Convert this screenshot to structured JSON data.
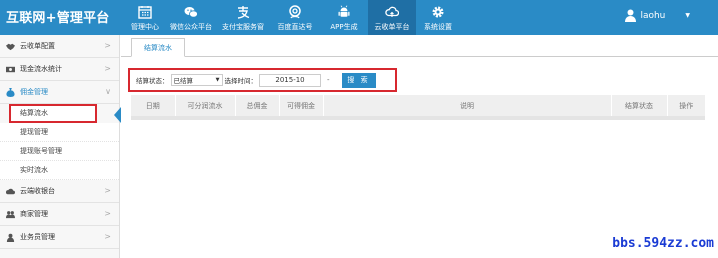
{
  "app": {
    "title": "互联网+管理平台"
  },
  "nav": {
    "items": [
      {
        "label": "管理中心",
        "icon": "calendar-grid-icon",
        "active": false
      },
      {
        "label": "微信公众平台",
        "icon": "wechat-icon",
        "active": false
      },
      {
        "label": "支付宝服务窗",
        "icon": "alipay-icon",
        "active": false
      },
      {
        "label": "百度直达号",
        "icon": "baidu-icon",
        "active": false
      },
      {
        "label": "APP生成",
        "icon": "android-icon",
        "active": false
      },
      {
        "label": "云收单平台",
        "icon": "cloud-upload-icon",
        "active": true
      },
      {
        "label": "系统设置",
        "icon": "gear-icon",
        "active": false
      }
    ]
  },
  "user": {
    "name": "laohu"
  },
  "sidebar": {
    "menus": [
      {
        "label": "云收单配置",
        "icon": "handshake-icon"
      },
      {
        "label": "现金流水统计",
        "icon": "cash-icon"
      },
      {
        "label": "佣金管理",
        "icon": "money-bag-icon",
        "open": true
      },
      {
        "label": "云端收银台",
        "icon": "cloud-icon"
      },
      {
        "label": "商家管理",
        "icon": "users-icon"
      },
      {
        "label": "业务员管理",
        "icon": "user-icon"
      }
    ],
    "sub_items": [
      "结算流水",
      "提现管理",
      "提现账号管理",
      "实时流水"
    ]
  },
  "tab": {
    "label": "结算流水"
  },
  "filter": {
    "status_label": "结算状态：",
    "status_value": "已结算",
    "time_label": "选择时间：",
    "time_value": "2015-10",
    "dash": "-",
    "search_label": "搜 索"
  },
  "table": {
    "headers": [
      "日期",
      "可分润流水",
      "总佣金",
      "可得佣金",
      "说明",
      "结算状态",
      "操作"
    ]
  },
  "watermark": "bbs.594zz.com",
  "colors": {
    "brand": "#2a8bc6",
    "highlight": "#d7282f"
  }
}
